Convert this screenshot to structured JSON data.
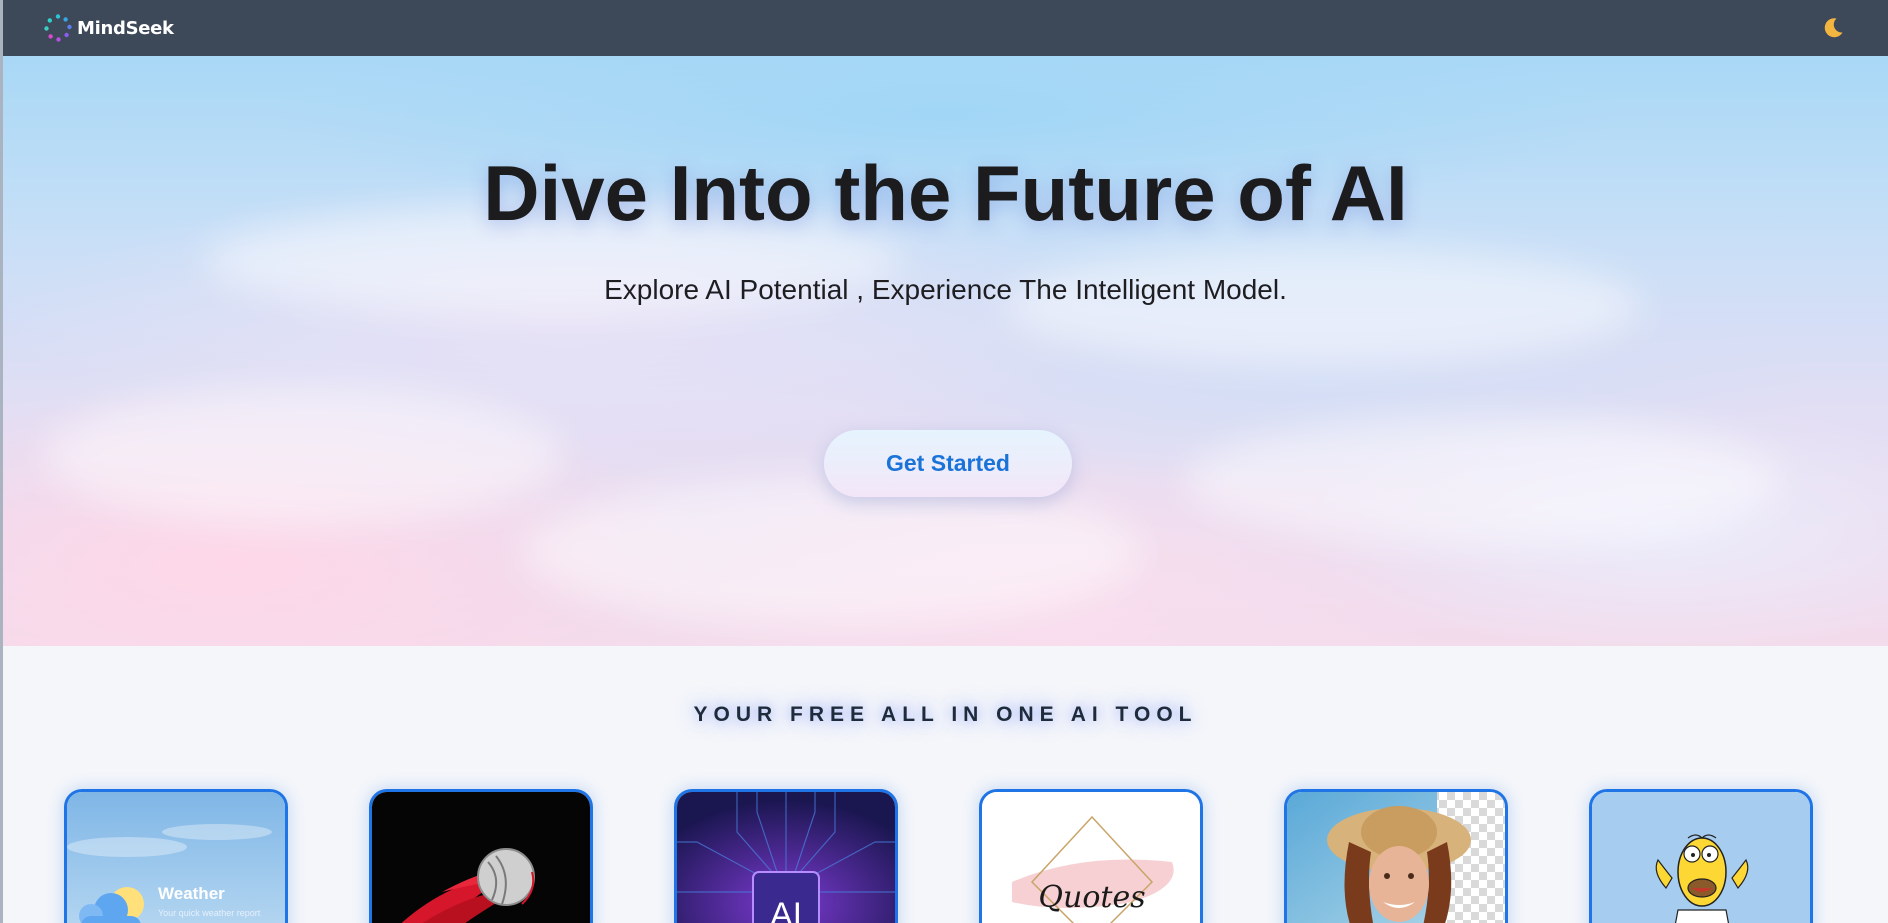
{
  "navbar": {
    "brand_name": "MindSeek",
    "logo_icon": "spinner-dots-logo-icon",
    "theme_toggle_icon": "crescent-moon-icon"
  },
  "hero": {
    "title": "Dive Into the Future of AI",
    "subtitle": "Explore AI Potential , Experience The Intelligent Model.",
    "cta_label": "Get Started"
  },
  "tools_section": {
    "heading": "YOUR FREE ALL IN ONE AI TOOL",
    "cards": [
      {
        "name": "weather",
        "title": "Weather",
        "caption": "Your quick weather report"
      },
      {
        "name": "cricket",
        "title": ""
      },
      {
        "name": "ai-chip",
        "title": "AI"
      },
      {
        "name": "quotes",
        "title": "Quotes"
      },
      {
        "name": "background-remover",
        "title": ""
      },
      {
        "name": "cartoon",
        "title": ""
      }
    ]
  },
  "colors": {
    "navbar_bg": "#3d4859",
    "accent_blue": "#1f74e6",
    "cta_text": "#1a73d9",
    "page_bg": "#f4f6fa"
  }
}
